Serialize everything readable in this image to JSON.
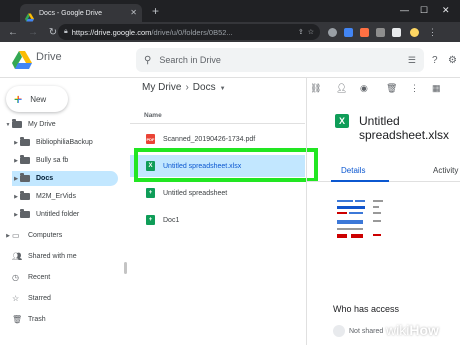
{
  "browser": {
    "tab_title": "Docs - Google Drive",
    "url_host": "https://drive.google.com",
    "url_path": "/drive/u/0/folders/0B52...",
    "new_tab": "+",
    "minimize": "—",
    "maximize": "☐",
    "close": "✕"
  },
  "drive": {
    "logo_text": "Drive",
    "search_placeholder": "Search in Drive"
  },
  "sidebar": {
    "new_label": "New",
    "my_drive": "My Drive",
    "folders": [
      "BibliophiliaBackup",
      "Bully sa fb",
      "Docs",
      "M2M_ErVids",
      "Untitled folder"
    ],
    "active_folder_index": 2,
    "items": [
      "Computers",
      "Shared with me",
      "Recent",
      "Starred",
      "Trash"
    ]
  },
  "main": {
    "breadcrumb": [
      "My Drive",
      "Docs"
    ],
    "column_header": "Name",
    "files": [
      {
        "name": "Scanned_20190426-1734.pdf",
        "type": "pdf-icon"
      },
      {
        "name": "Untitled spreadsheet.xlsx",
        "type": "excel-icon",
        "selected": true
      },
      {
        "name": "Untitled spreadsheet",
        "type": "sheets-icon"
      },
      {
        "name": "Doc1",
        "type": "sheets-icon"
      }
    ]
  },
  "details": {
    "title": "Untitled spreadsheet.xlsx",
    "tab_details": "Details",
    "tab_activity": "Activity",
    "who_has_access": "Who has access",
    "access_text": "Not shared"
  },
  "watermark": {
    "wiki": "wiki",
    "how": "How"
  },
  "colors": {
    "selected": "#c2e7ff",
    "highlight": "#22e622",
    "accent": "#0b57d0"
  }
}
